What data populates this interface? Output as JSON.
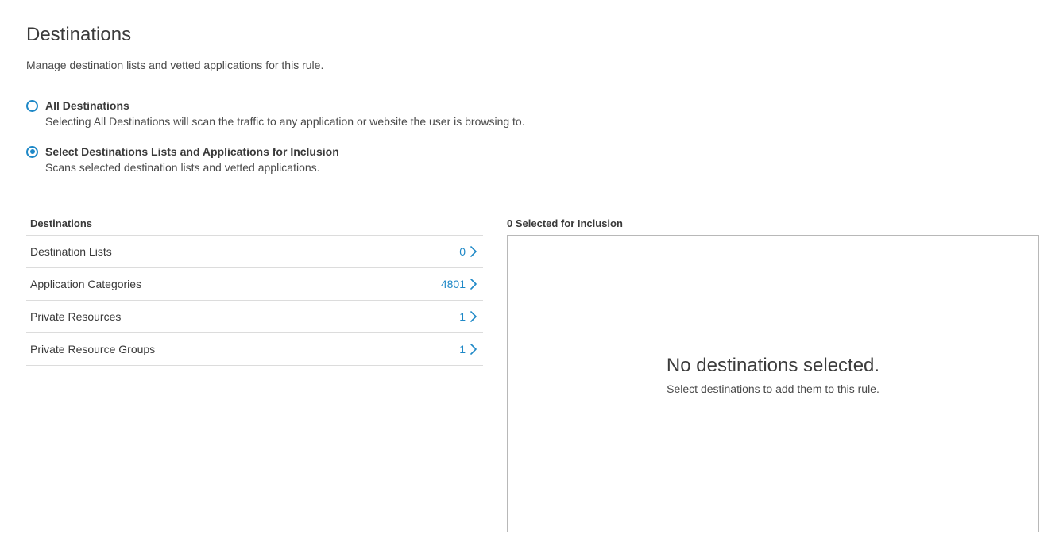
{
  "page": {
    "title": "Destinations",
    "subtitle": "Manage destination lists and vetted applications for this rule."
  },
  "options": [
    {
      "label": "All Destinations",
      "description": "Selecting All Destinations will scan the traffic to any application or website the user is browsing to.",
      "selected": false
    },
    {
      "label": "Select Destinations Lists and Applications for Inclusion",
      "description": "Scans selected destination lists and vetted applications.",
      "selected": true
    }
  ],
  "destinations": {
    "header": "Destinations",
    "items": [
      {
        "label": "Destination Lists",
        "count": "0"
      },
      {
        "label": "Application Categories",
        "count": "4801"
      },
      {
        "label": "Private Resources",
        "count": "1"
      },
      {
        "label": "Private Resource Groups",
        "count": "1"
      }
    ]
  },
  "selection": {
    "header": "0 Selected for Inclusion",
    "empty_title": "No destinations selected.",
    "empty_description": "Select destinations to add them to this rule."
  },
  "colors": {
    "accent": "#1e88c7",
    "text": "#3a3a3a",
    "divider": "#dcdcdc"
  },
  "icons": {
    "row_chevron": "chevron-right-icon"
  }
}
